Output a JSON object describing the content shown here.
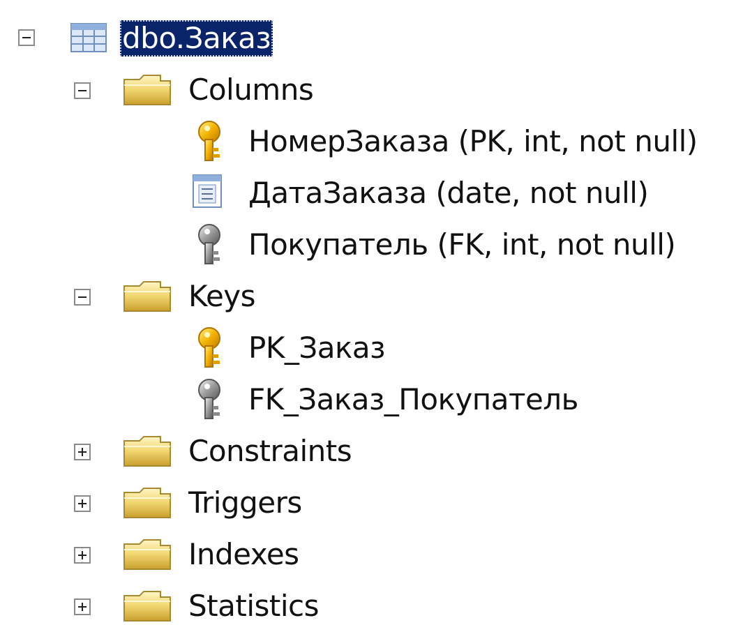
{
  "tree": {
    "table": {
      "label": "dbo.Заказ",
      "icon": "table-icon",
      "expanded": true,
      "selected": true
    },
    "columns": {
      "label": "Columns",
      "icon": "folder-icon",
      "expanded": true,
      "items": [
        {
          "label": "НомерЗаказа (PK, int, not null)",
          "icon": "primary-key-icon"
        },
        {
          "label": "ДатаЗаказа (date, not null)",
          "icon": "column-icon"
        },
        {
          "label": "Покупатель (FK, int, not null)",
          "icon": "foreign-key-icon"
        }
      ]
    },
    "keys": {
      "label": "Keys",
      "icon": "folder-icon",
      "expanded": true,
      "items": [
        {
          "label": "PK_Заказ",
          "icon": "primary-key-icon"
        },
        {
          "label": "FK_Заказ_Покупатель",
          "icon": "foreign-key-icon"
        }
      ]
    },
    "constraints": {
      "label": "Constraints",
      "icon": "folder-icon",
      "expanded": false
    },
    "triggers": {
      "label": "Triggers",
      "icon": "folder-icon",
      "expanded": false
    },
    "indexes": {
      "label": "Indexes",
      "icon": "folder-icon",
      "expanded": false
    },
    "statistics": {
      "label": "Statistics",
      "icon": "folder-icon",
      "expanded": false
    }
  },
  "colors": {
    "selection_bg": "#0a246a",
    "selection_text": "#ffffff",
    "folder": "#f2d06b",
    "primary_key": "#f0b400",
    "foreign_key": "#8a8a8a"
  }
}
